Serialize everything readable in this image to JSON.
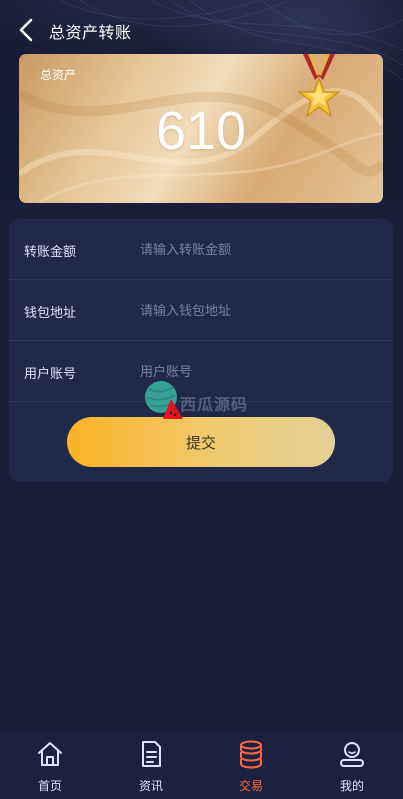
{
  "header": {
    "title": "总资产转账"
  },
  "asset_card": {
    "label": "总资产",
    "value": "610"
  },
  "form": {
    "rows": [
      {
        "label": "转账金额",
        "placeholder": "请输入转账金额",
        "value": ""
      },
      {
        "label": "钱包地址",
        "placeholder": "请输入钱包地址",
        "value": ""
      },
      {
        "label": "用户账号",
        "placeholder": "用户账号",
        "value": ""
      }
    ],
    "submit_label": "提交"
  },
  "watermark": {
    "text": "西瓜源码"
  },
  "tabbar": {
    "items": [
      {
        "label": "首页",
        "icon": "home-icon",
        "active": false
      },
      {
        "label": "资讯",
        "icon": "news-icon",
        "active": false
      },
      {
        "label": "交易",
        "icon": "trade-icon",
        "active": true
      },
      {
        "label": "我的",
        "icon": "profile-icon",
        "active": false
      }
    ]
  },
  "colors": {
    "background": "#1a1e3a",
    "panel": "#22284a",
    "active_tab": "#ff6a3d",
    "button_start": "#fbb224",
    "button_end": "#e3cf96"
  }
}
